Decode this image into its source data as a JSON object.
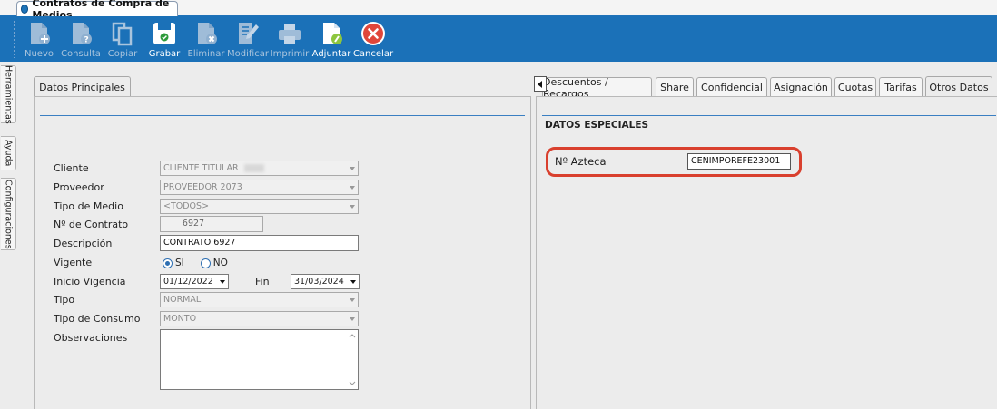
{
  "window_tab": {
    "title": "Contratos de Compra de Medios"
  },
  "toolbar": {
    "nuevo": "Nuevo",
    "consulta": "Consulta",
    "copiar": "Copiar",
    "grabar": "Grabar",
    "eliminar": "Eliminar",
    "modificar": "Modificar",
    "imprimir": "Imprimir",
    "adjuntar": "Adjuntar",
    "cancelar": "Cancelar"
  },
  "side_tabs": {
    "herramientas": "Herramientas",
    "ayuda": "Ayuda",
    "configuraciones": "Configuraciones"
  },
  "left_panel": {
    "tab": "Datos Principales",
    "fields": {
      "cliente_label": "Cliente",
      "cliente_value": "CLIENTE TITULAR",
      "proveedor_label": "Proveedor",
      "proveedor_value": "PROVEEDOR 2073",
      "tipo_medio_label": "Tipo de Medio",
      "tipo_medio_value": "<TODOS>",
      "contrato_label": "Nº de Contrato",
      "contrato_value": "6927",
      "descripcion_label": "Descripción",
      "descripcion_value": "CONTRATO 6927",
      "vigente_label": "Vigente",
      "vigente_si": "SI",
      "vigente_no": "NO",
      "inicio_label": "Inicio Vigencia",
      "inicio_value": "01/12/2022",
      "fin_label": "Fin",
      "fin_value": "31/03/2024",
      "tipo_label": "Tipo",
      "tipo_value": "NORMAL",
      "consumo_label": "Tipo de Consumo",
      "consumo_value": "MONTO",
      "observaciones_label": "Observaciones",
      "observaciones_value": ""
    }
  },
  "right_panel": {
    "tabs": [
      "Descuentos / Recargos",
      "Share",
      "Confidencial",
      "Asignación",
      "Cuotas",
      "Tarifas",
      "Otros Datos"
    ],
    "active_tab": "Otros Datos",
    "section_title": "DATOS ESPECIALES",
    "azteca_label": "Nº Azteca",
    "azteca_value": "CENIMPOREFE23001"
  },
  "colors": {
    "toolbar": "#1b71b8",
    "highlight": "#d9402e"
  }
}
